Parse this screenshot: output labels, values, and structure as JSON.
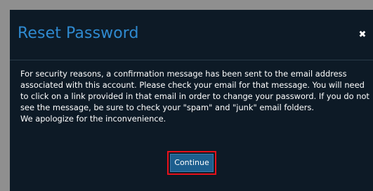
{
  "dialog": {
    "title": "Reset Password",
    "close_glyph": "✖",
    "close_icon": "close-icon",
    "message": "For security reasons, a confirmation message has been sent to the email address associated with this account. Please check your email for that message. You will need to click on a link provided in that email in order to change your password. If you do not see the message, be sure to check your \"spam\" and \"junk\" email folders.",
    "apology": "We apologize for the inconvenience.",
    "continue_label": "Continue"
  },
  "colors": {
    "page_background": "#8f8f8f",
    "dialog_background": "#0d1a26",
    "title": "#2f8ad0",
    "button": "#1c5e8e",
    "highlight_border": "#e8111a"
  }
}
